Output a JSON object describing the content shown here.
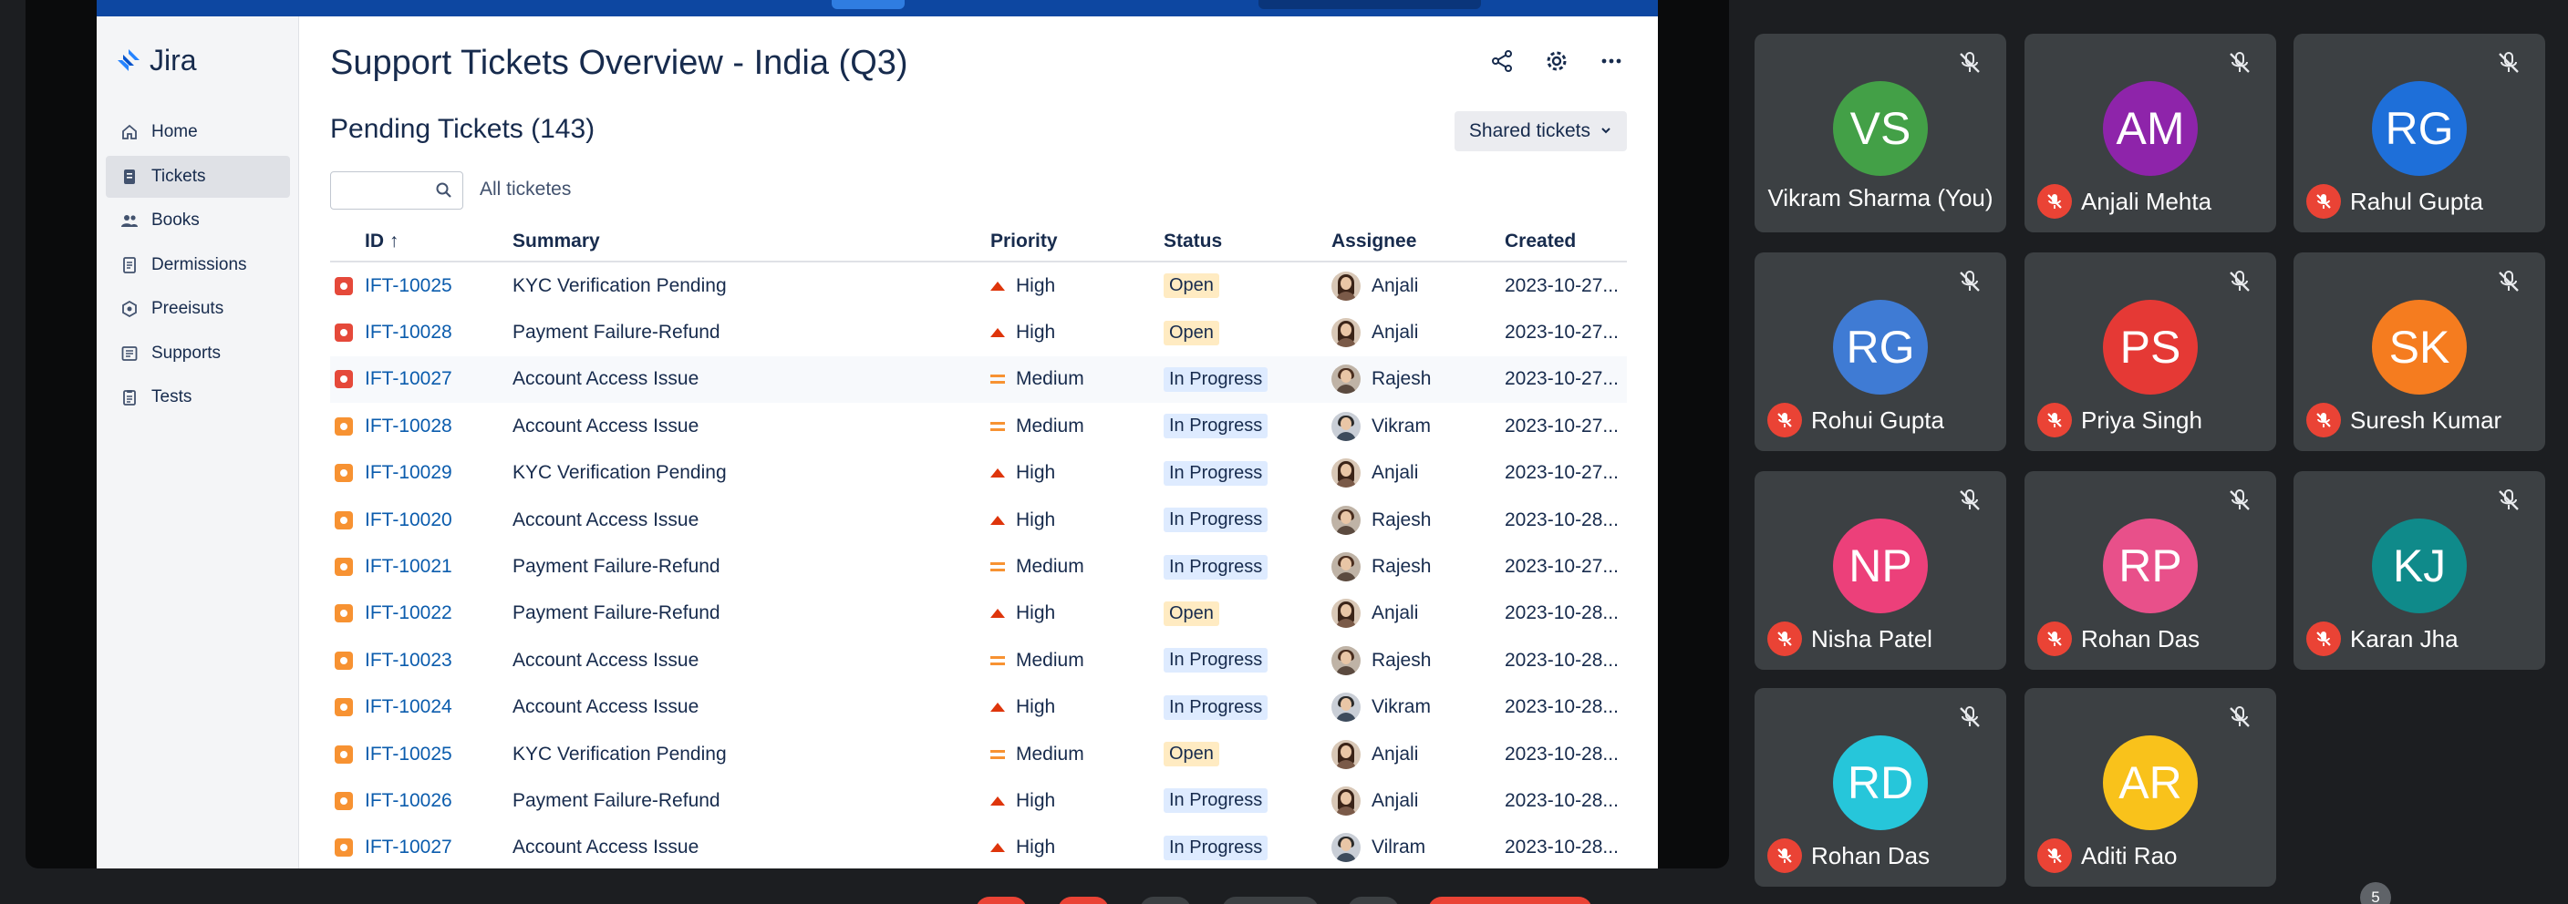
{
  "app": {
    "name": "Jira"
  },
  "nav": [
    {
      "label": "Home",
      "icon": "home-icon",
      "active": false
    },
    {
      "label": "Tickets",
      "icon": "ticket-icon",
      "active": true
    },
    {
      "label": "Books",
      "icon": "people-icon",
      "active": false
    },
    {
      "label": "Dermissions",
      "icon": "document-icon",
      "active": false
    },
    {
      "label": "Preeisuts",
      "icon": "settings-icon",
      "active": false
    },
    {
      "label": "Supports",
      "icon": "grid-icon",
      "active": false
    },
    {
      "label": "Tests",
      "icon": "clipboard-icon",
      "active": false
    }
  ],
  "page": {
    "title": "Support Tickets Overview - India (Q3)",
    "section_title": "Pending Tickets (143)",
    "shared_button": "Shared tickets",
    "search_placeholder": "",
    "filter_label": "All ticketes"
  },
  "table": {
    "headers": {
      "id": "ID ↑",
      "summary": "Summary",
      "priority": "Priority",
      "status": "Status",
      "assignee": "Assignee",
      "created": "Created"
    },
    "rows": [
      {
        "type_color": "#e5493a",
        "id": "IFT-10025",
        "summary": "KYC Verification Pending",
        "priority": "High",
        "status": "Open",
        "assignee": "Anjali",
        "avatar": "f",
        "created": "2023-10-27..."
      },
      {
        "type_color": "#e5493a",
        "id": "IFT-10028",
        "summary": "Payment Failure-Refund",
        "priority": "High",
        "status": "Open",
        "assignee": "Anjali",
        "avatar": "f",
        "created": "2023-10-27..."
      },
      {
        "type_color": "#e5493a",
        "id": "IFT-10027",
        "summary": "Account Access Issue",
        "priority": "Medium",
        "status": "In Progress",
        "assignee": "Rajesh",
        "avatar": "m",
        "created": "2023-10-27..."
      },
      {
        "type_color": "#f79232",
        "id": "IFT-10028",
        "summary": "Account Access Issue",
        "priority": "Medium",
        "status": "In Progress",
        "assignee": "Vikram",
        "avatar": "m2",
        "created": "2023-10-27..."
      },
      {
        "type_color": "#f79232",
        "id": "IFT-10029",
        "summary": "KYC Verification Pending",
        "priority": "High",
        "status": "In Progress",
        "assignee": "Anjali",
        "avatar": "f",
        "created": "2023-10-27..."
      },
      {
        "type_color": "#f79232",
        "id": "IFT-10020",
        "summary": "Account Access Issue",
        "priority": "High",
        "status": "In Progress",
        "assignee": "Rajesh",
        "avatar": "m",
        "created": "2023-10-28..."
      },
      {
        "type_color": "#f79232",
        "id": "IFT-10021",
        "summary": "Payment Failure-Refund",
        "priority": "Medium",
        "status": "In Progress",
        "assignee": "Rajesh",
        "avatar": "m",
        "created": "2023-10-27..."
      },
      {
        "type_color": "#f79232",
        "id": "IFT-10022",
        "summary": "Payment Failure-Refund",
        "priority": "High",
        "status": "Open",
        "assignee": "Anjali",
        "avatar": "f",
        "created": "2023-10-28..."
      },
      {
        "type_color": "#f79232",
        "id": "IFT-10023",
        "summary": "Account Access Issue",
        "priority": "Medium",
        "status": "In Progress",
        "assignee": "Rajesh",
        "avatar": "m",
        "created": "2023-10-28..."
      },
      {
        "type_color": "#f79232",
        "id": "IFT-10024",
        "summary": "Account Access Issue",
        "priority": "High",
        "status": "In Progress",
        "assignee": "Vikram",
        "avatar": "m2",
        "created": "2023-10-28..."
      },
      {
        "type_color": "#f79232",
        "id": "IFT-10025",
        "summary": "KYC Verification Pending",
        "priority": "Medium",
        "status": "Open",
        "assignee": "Anjali",
        "avatar": "f",
        "created": "2023-10-28..."
      },
      {
        "type_color": "#f79232",
        "id": "IFT-10026",
        "summary": "Payment Failure-Refund",
        "priority": "High",
        "status": "In Progress",
        "assignee": "Anjali",
        "avatar": "f",
        "created": "2023-10-28..."
      },
      {
        "type_color": "#f79232",
        "id": "IFT-10027",
        "summary": "Account Access Issue",
        "priority": "High",
        "status": "In Progress",
        "assignee": "Vilram",
        "avatar": "m2",
        "created": "2023-10-28..."
      }
    ]
  },
  "participants": [
    {
      "initials": "VS",
      "name": "Vikram Sharma (You)",
      "color": "#43a047",
      "is_self": true
    },
    {
      "initials": "AM",
      "name": "Anjali Mehta",
      "color": "#8e24aa",
      "is_self": false
    },
    {
      "initials": "RG",
      "name": "Rahul Gupta",
      "color": "#1e6fd9",
      "is_self": false
    },
    {
      "initials": "RG",
      "name": "Rohui Gupta",
      "color": "#3f7bd4",
      "is_self": false
    },
    {
      "initials": "PS",
      "name": "Priya Singh",
      "color": "#e53935",
      "is_self": false
    },
    {
      "initials": "SK",
      "name": "Suresh Kumar",
      "color": "#f57c1f",
      "is_self": false
    },
    {
      "initials": "NP",
      "name": "Nisha Patel",
      "color": "#ec407a",
      "is_self": false
    },
    {
      "initials": "RP",
      "name": "Rohan Das",
      "color": "#e8508a",
      "is_self": false
    },
    {
      "initials": "KJ",
      "name": "Karan Jha",
      "color": "#0f8a8a",
      "is_self": false
    },
    {
      "initials": "RD",
      "name": "Rohan Das",
      "color": "#26c6da",
      "is_self": false
    },
    {
      "initials": "AR",
      "name": "Aditi Rao",
      "color": "#f9c21b",
      "is_self": false
    }
  ],
  "participant_overflow_count": "5"
}
